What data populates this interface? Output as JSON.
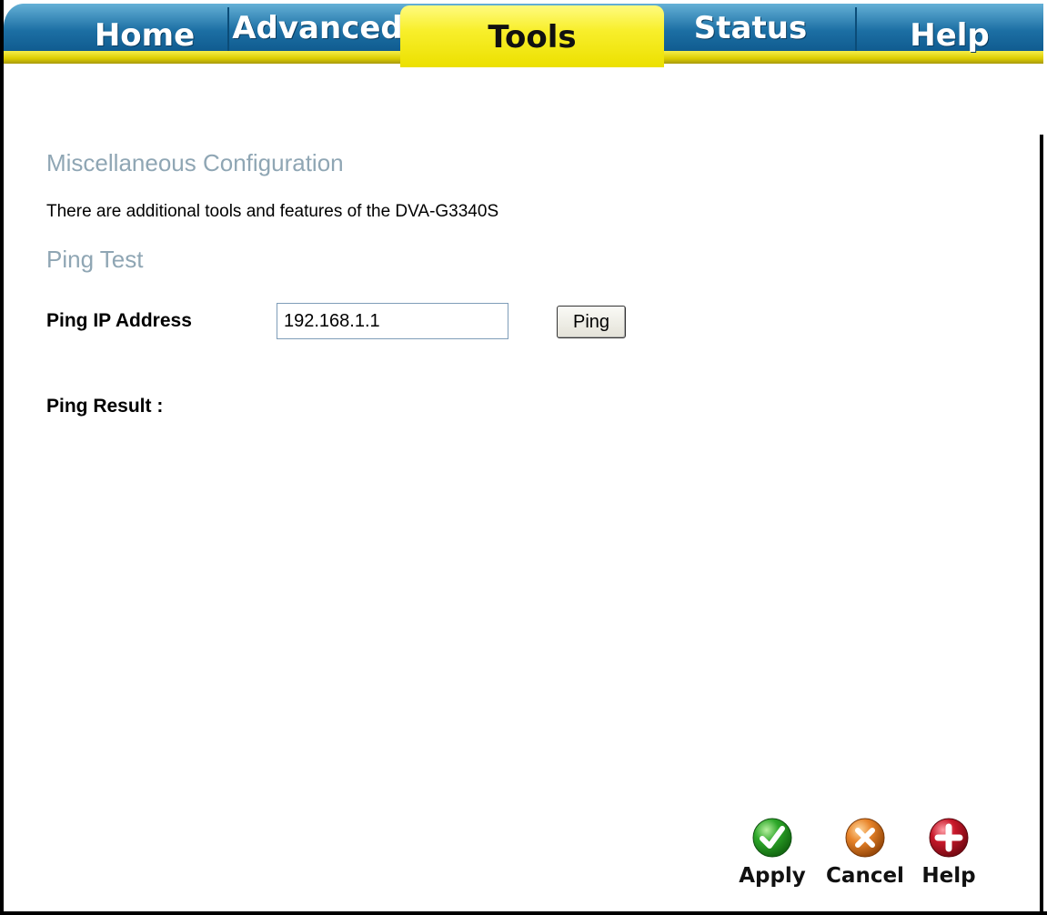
{
  "nav": {
    "tabs": [
      {
        "label": "Home"
      },
      {
        "label": "Advanced"
      },
      {
        "label": "Tools"
      },
      {
        "label": "Status"
      },
      {
        "label": "Help"
      }
    ],
    "active_tab": "Tools"
  },
  "main": {
    "section_title": "Miscellaneous Configuration",
    "description": "There are additional tools and features of the DVA-G3340S",
    "ping_section_title": "Ping Test",
    "ping_ip_label": "Ping IP Address",
    "ping_ip_value": "192.168.1.1",
    "ping_button_label": "Ping",
    "ping_result_label": "Ping Result :"
  },
  "actions": {
    "apply_label": "Apply",
    "cancel_label": "Cancel",
    "help_label": "Help"
  },
  "colors": {
    "nav_blue": "#1c6fa4",
    "nav_yellow": "#f8ef2c",
    "heading_gray": "#8fa6b4",
    "apply_green": "#2ea82a",
    "cancel_orange": "#e8842a",
    "help_red": "#c8182a"
  },
  "icons": {
    "apply": "check-icon",
    "cancel": "x-icon",
    "help": "plus-icon"
  }
}
